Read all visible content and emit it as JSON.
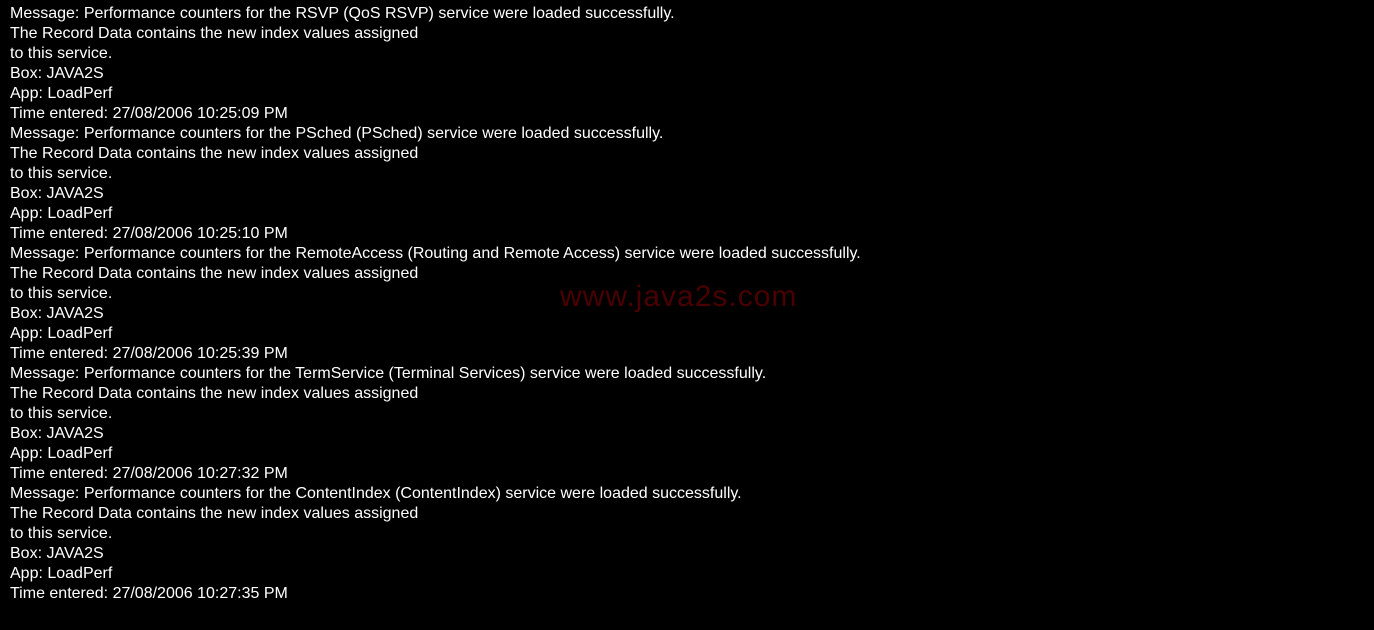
{
  "watermark": "www.java2s.com",
  "labels": {
    "message": "Message: ",
    "box": "Box: ",
    "app": "App: ",
    "time_entered": "Time entered: "
  },
  "entries": [
    {
      "message_line1": "Performance counters for the RSVP (QoS RSVP) service were loaded successfully.",
      "message_line2": "The Record Data contains the new index values assigned",
      "message_line3": "to this service.",
      "box": "JAVA2S",
      "app": "LoadPerf",
      "time_entered": "27/08/2006 10:25:09 PM"
    },
    {
      "message_line1": "Performance counters for the PSched (PSched) service were loaded successfully.",
      "message_line2": "The Record Data contains the new index values assigned",
      "message_line3": "to this service.",
      "box": "JAVA2S",
      "app": "LoadPerf",
      "time_entered": "27/08/2006 10:25:10 PM"
    },
    {
      "message_line1": "Performance counters for the RemoteAccess (Routing and Remote Access) service were loaded successfully.",
      "message_line2": "The Record Data contains the new index values assigned",
      "message_line3": "to this service.",
      "box": "JAVA2S",
      "app": "LoadPerf",
      "time_entered": "27/08/2006 10:25:39 PM"
    },
    {
      "message_line1": "Performance counters for the TermService (Terminal Services) service were loaded successfully.",
      "message_line2": "The Record Data contains the new index values assigned",
      "message_line3": "to this service.",
      "box": "JAVA2S",
      "app": "LoadPerf",
      "time_entered": "27/08/2006 10:27:32 PM"
    },
    {
      "message_line1": "Performance counters for the ContentIndex (ContentIndex) service were loaded successfully.",
      "message_line2": "The Record Data contains the new index values assigned",
      "message_line3": "to this service.",
      "box": "JAVA2S",
      "app": "LoadPerf",
      "time_entered": "27/08/2006 10:27:35 PM"
    }
  ]
}
